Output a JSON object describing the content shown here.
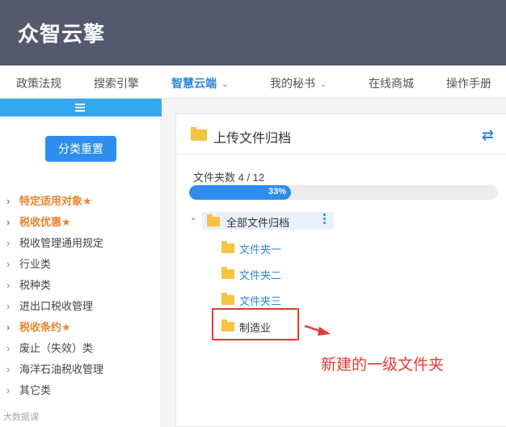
{
  "header": {
    "logo": "众智云擎"
  },
  "nav": {
    "items": [
      {
        "label": "政策法规"
      },
      {
        "label": "搜索引擎"
      },
      {
        "label": "智慧云端"
      },
      {
        "label": "我的秘书"
      },
      {
        "label": "在线商城"
      },
      {
        "label": "操作手册"
      }
    ],
    "active_color": "#2f86d8"
  },
  "sidebar": {
    "reset_label": "分类重置",
    "items": [
      {
        "label": "特定适用对象",
        "star": "★"
      },
      {
        "label": "税收优惠",
        "star": "★"
      },
      {
        "label": "税收管理通用规定"
      },
      {
        "label": "行业类"
      },
      {
        "label": "税种类"
      },
      {
        "label": "进出口税收管理"
      },
      {
        "label": "税收条约",
        "star": "★"
      },
      {
        "label": "废止（失效）类"
      },
      {
        "label": "海洋石油税收管理"
      },
      {
        "label": "其它类"
      }
    ],
    "highlight_color": "#e8842a"
  },
  "panel": {
    "title": "上传文件归档",
    "count_label": "文件夹数 4 / 12",
    "progress": {
      "percent": 33,
      "label": "33%"
    },
    "tree": {
      "root": "全部文件归档",
      "children": [
        {
          "label": "文件夹一"
        },
        {
          "label": "文件夹二"
        },
        {
          "label": "文件夹三"
        },
        {
          "label": "制造业"
        }
      ]
    }
  },
  "annotation": {
    "text": "新建的一级文件夹",
    "color": "#e53935"
  },
  "watermark": "大数据课",
  "colors": {
    "header_bg": "#535a6e",
    "primary": "#2d8ef0",
    "folder": "#f6c343"
  }
}
